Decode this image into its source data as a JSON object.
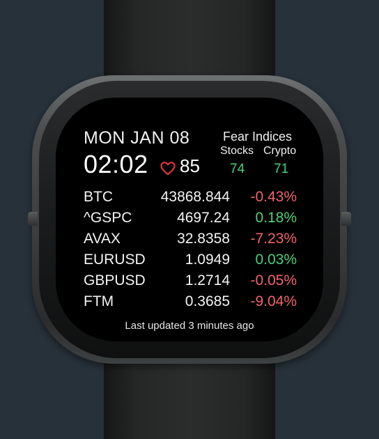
{
  "watch": {
    "date": "MON JAN 08",
    "time": "02:02",
    "heart_rate": "85",
    "colors": {
      "background": "#27313a",
      "screen": "#000000",
      "positive": "#4fcf78",
      "negative": "#f0646b",
      "heart": "#e2353f"
    }
  },
  "fear": {
    "title": "Fear Indices",
    "stocks_label": "Stocks",
    "crypto_label": "Crypto",
    "stocks_value": "74",
    "crypto_value": "71"
  },
  "tickers": [
    {
      "symbol": "BTC",
      "price": "43868.844",
      "change": "-0.43%",
      "direction": "negative"
    },
    {
      "symbol": "^GSPC",
      "price": "4697.24",
      "change": "0.18%",
      "direction": "positive"
    },
    {
      "symbol": "AVAX",
      "price": "32.8358",
      "change": "-7.23%",
      "direction": "negative"
    },
    {
      "symbol": "EURUSD",
      "price": "1.0949",
      "change": "0.03%",
      "direction": "positive"
    },
    {
      "symbol": "GBPUSD",
      "price": "1.2714",
      "change": "-0.05%",
      "direction": "negative"
    },
    {
      "symbol": "FTM",
      "price": "0.3685",
      "change": "-9.04%",
      "direction": "negative"
    }
  ],
  "status": {
    "updated": "Last updated 3 minutes ago"
  },
  "icons": {
    "heart": "heart-icon"
  }
}
